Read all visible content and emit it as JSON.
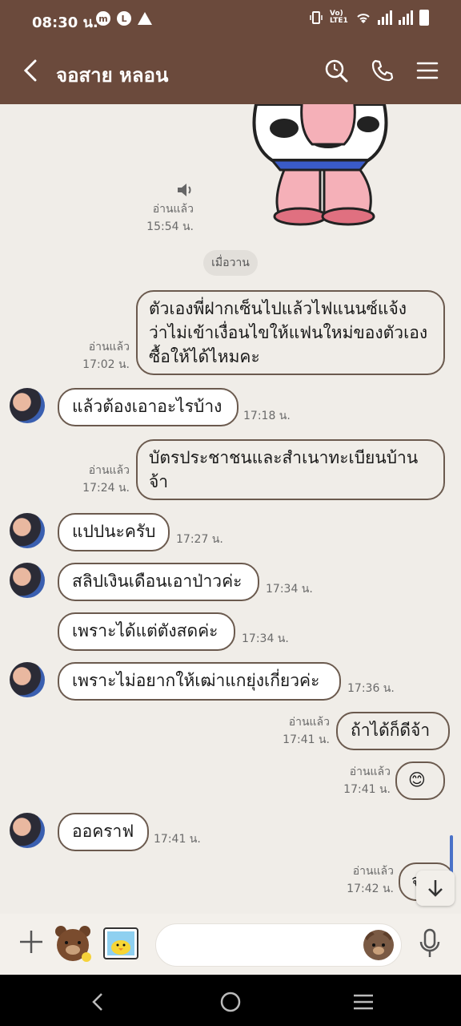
{
  "status_bar": {
    "time": "08:30 น.",
    "network_text": "Vo) LTE1"
  },
  "header": {
    "title": "จอสาย หลอน"
  },
  "chat": {
    "sticker_meta": {
      "read": "อ่านแล้ว",
      "time": "15:54 น."
    },
    "date_separator": "เมื่อวาน",
    "messages": [
      {
        "lines": [
          "ตัวเองพี่ฝากเซ็นไปแล้วไฟแนนซ์แจ้ง",
          "ว่าไม่เข้าเงื่อนไขให้แฟนใหม่ของตัวเอง",
          "ซื้อให้ได้ไหมคะ"
        ],
        "read": "อ่านแล้ว",
        "time": "17:02 น."
      },
      {
        "text": "แล้วต้องเอาอะไรบ้าง",
        "time": "17:18 น."
      },
      {
        "lines": [
          "บัตรประชาชนและสำเนาทะเบียนบ้าน",
          "จ้า"
        ],
        "read": "อ่านแล้ว",
        "time": "17:24 น."
      },
      {
        "text": "แปปนะครับ",
        "time": "17:27 น."
      },
      {
        "text": "สลิปเงินเดือนเอาป่าวค่ะ",
        "time": "17:34 น."
      },
      {
        "text": "เพราะได้แต่ตังสดค่ะ",
        "time": "17:34 น."
      },
      {
        "text": "เพราะไม่อยากให้เฒ่าแกยุ่งเกี่ยวค่ะ",
        "time": "17:36 น."
      },
      {
        "text": "ถ้าได้ก็ดีจ้า",
        "read": "อ่านแล้ว",
        "time": "17:41 น."
      },
      {
        "text": "😊",
        "read": "อ่านแล้ว",
        "time": "17:41 น."
      },
      {
        "text": "ออคราฟ",
        "time": "17:41 น."
      },
      {
        "text": "จ",
        "read": "อ่านแล้ว",
        "time": "17:42 น."
      }
    ]
  },
  "input": {
    "placeholder": ""
  }
}
